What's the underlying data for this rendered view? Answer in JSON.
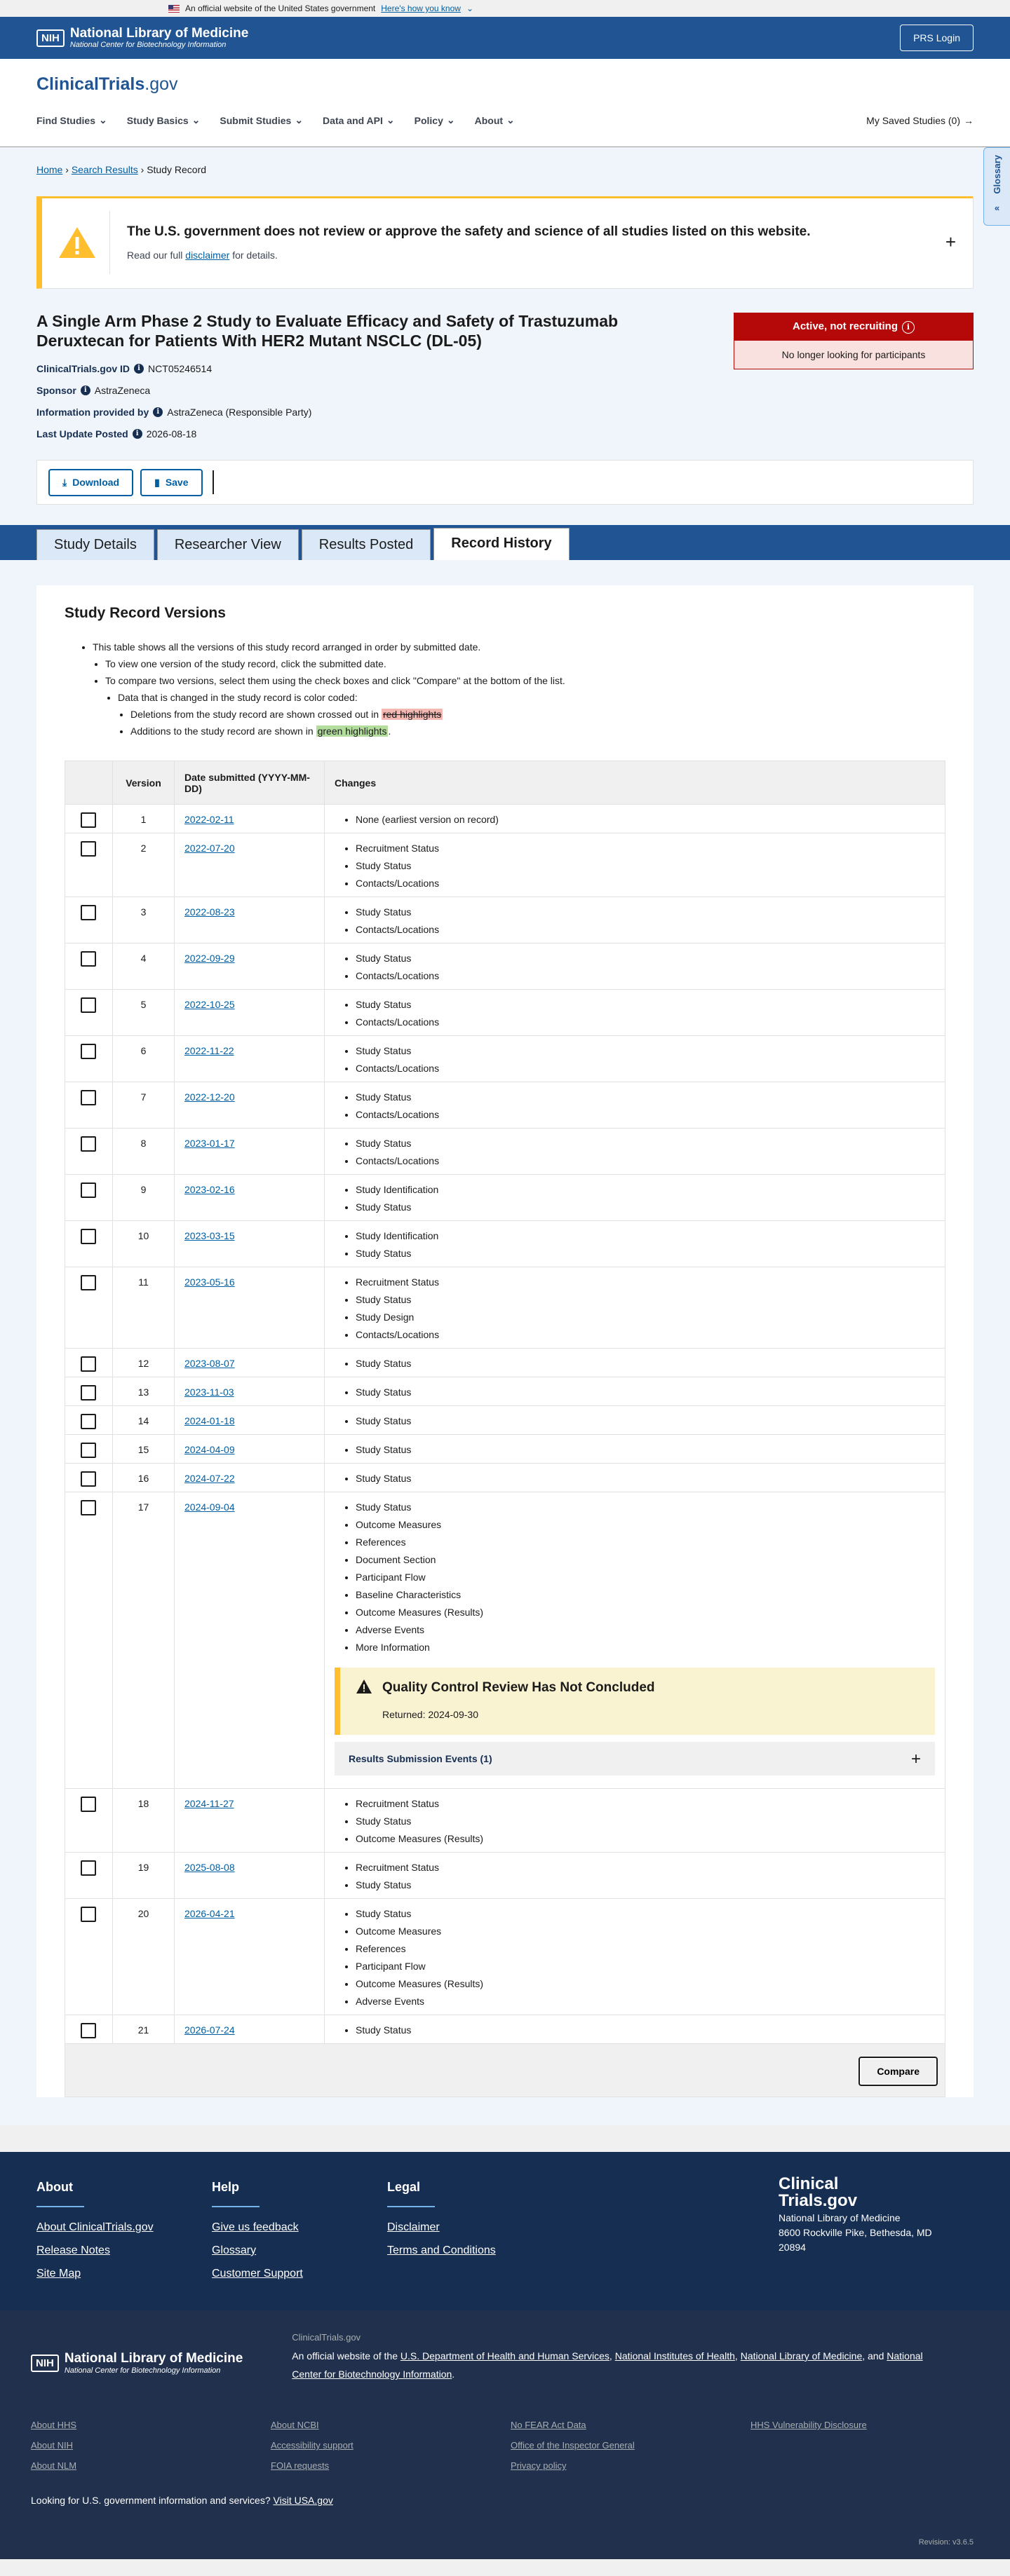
{
  "gov_banner": {
    "text": "An official website of the United States government",
    "link": "Here's how you know"
  },
  "nlm": {
    "nih": "NIH",
    "title": "National Library of Medicine",
    "subtitle": "National Center for Biotechnology Information",
    "prs_login": "PRS Login"
  },
  "site": {
    "logo_main": "ClinicalTrials",
    "logo_suffix": ".gov"
  },
  "nav": {
    "items": [
      "Find Studies",
      "Study Basics",
      "Submit Studies",
      "Data and API",
      "Policy",
      "About"
    ],
    "saved": "My Saved Studies (0)"
  },
  "breadcrumb": {
    "home": "Home",
    "results": "Search Results",
    "current": "Study Record"
  },
  "glossary": "Glossary",
  "alert": {
    "title": "The U.S. government does not review or approve the safety and science of all studies listed on this website.",
    "pre": "Read our full",
    "link": "disclaimer",
    "post": "for details."
  },
  "study": {
    "title": "A Single Arm Phase 2 Study to Evaluate Efficacy and Safety of Trastuzumab Deruxtecan for Patients With HER2 Mutant NSCLC (DL-05)",
    "id_label": "ClinicalTrials.gov ID",
    "id": "NCT05246514",
    "sponsor_label": "Sponsor",
    "sponsor": "AstraZeneca",
    "info_label": "Information provided by",
    "info": "AstraZeneca (Responsible Party)",
    "posted_label": "Last Update Posted",
    "posted": "2026-08-18",
    "status": "Active, not recruiting",
    "status_sub": "No longer looking for participants"
  },
  "actions": {
    "download": "Download",
    "save": "Save"
  },
  "tabs": [
    "Study Details",
    "Researcher View",
    "Results Posted",
    "Record History"
  ],
  "versions": {
    "heading": "Study Record Versions",
    "bullets": {
      "b1": "This table shows all the versions of this study record arranged in order by submitted date.",
      "b2": "To view one version of the study record, click the submitted date.",
      "b3": "To compare two versions, select them using the check boxes and click \"Compare\" at the bottom of the list.",
      "b4": "Data that is changed in the study record is color coded:",
      "b5_pre": "Deletions from the study record are shown crossed out in",
      "b5_hl": "red highlights",
      "b6_pre": "Additions to the study record are shown in",
      "b6_hl": "green highlights",
      "b6_post": "."
    },
    "col_version": "Version",
    "col_date": "Date submitted (YYYY-MM-DD)",
    "col_changes": "Changes",
    "rows": [
      {
        "v": "1",
        "d": "2022-02-11",
        "c": [
          "None (earliest version on record)"
        ]
      },
      {
        "v": "2",
        "d": "2022-07-20",
        "c": [
          "Recruitment Status",
          "Study Status",
          "Contacts/Locations"
        ]
      },
      {
        "v": "3",
        "d": "2022-08-23",
        "c": [
          "Study Status",
          "Contacts/Locations"
        ]
      },
      {
        "v": "4",
        "d": "2022-09-29",
        "c": [
          "Study Status",
          "Contacts/Locations"
        ]
      },
      {
        "v": "5",
        "d": "2022-10-25",
        "c": [
          "Study Status",
          "Contacts/Locations"
        ]
      },
      {
        "v": "6",
        "d": "2022-11-22",
        "c": [
          "Study Status",
          "Contacts/Locations"
        ]
      },
      {
        "v": "7",
        "d": "2022-12-20",
        "c": [
          "Study Status",
          "Contacts/Locations"
        ]
      },
      {
        "v": "8",
        "d": "2023-01-17",
        "c": [
          "Study Status",
          "Contacts/Locations"
        ]
      },
      {
        "v": "9",
        "d": "2023-02-16",
        "c": [
          "Study Identification",
          "Study Status"
        ]
      },
      {
        "v": "10",
        "d": "2023-03-15",
        "c": [
          "Study Identification",
          "Study Status"
        ]
      },
      {
        "v": "11",
        "d": "2023-05-16",
        "c": [
          "Recruitment Status",
          "Study Status",
          "Study Design",
          "Contacts/Locations"
        ]
      },
      {
        "v": "12",
        "d": "2023-08-07",
        "c": [
          "Study Status"
        ]
      },
      {
        "v": "13",
        "d": "2023-11-03",
        "c": [
          "Study Status"
        ]
      },
      {
        "v": "14",
        "d": "2024-01-18",
        "c": [
          "Study Status"
        ]
      },
      {
        "v": "15",
        "d": "2024-04-09",
        "c": [
          "Study Status"
        ]
      },
      {
        "v": "16",
        "d": "2024-07-22",
        "c": [
          "Study Status"
        ]
      },
      {
        "v": "17",
        "d": "2024-09-04",
        "c": [
          "Study Status",
          "Outcome Measures",
          "References",
          "Document Section",
          "Participant Flow",
          "Baseline Characteristics",
          "Outcome Measures (Results)",
          "Adverse Events",
          "More Information"
        ],
        "qc": true
      },
      {
        "v": "18",
        "d": "2024-11-27",
        "c": [
          "Recruitment Status",
          "Study Status",
          "Outcome Measures (Results)"
        ]
      },
      {
        "v": "19",
        "d": "2025-08-08",
        "c": [
          "Recruitment Status",
          "Study Status"
        ]
      },
      {
        "v": "20",
        "d": "2026-04-21",
        "c": [
          "Study Status",
          "Outcome Measures",
          "References",
          "Participant Flow",
          "Outcome Measures (Results)",
          "Adverse Events"
        ]
      },
      {
        "v": "21",
        "d": "2026-07-24",
        "c": [
          "Study Status"
        ]
      }
    ],
    "qc_title": "Quality Control Review Has Not Concluded",
    "qc_returned": "Returned: 2024-09-30",
    "rse": "Results Submission Events (1)",
    "compare": "Compare"
  },
  "footer": {
    "about": {
      "heading": "About",
      "links": [
        "About ClinicalTrials.gov",
        "Release Notes",
        "Site Map"
      ]
    },
    "help": {
      "heading": "Help",
      "links": [
        "Give us feedback",
        "Glossary",
        "Customer Support"
      ]
    },
    "legal": {
      "heading": "Legal",
      "links": [
        "Disclaimer",
        "Terms and Conditions"
      ]
    },
    "brand": {
      "l1": "Clinical",
      "l2": "Trials.gov",
      "org": "National Library of Medicine",
      "addr1": "8600 Rockville Pike, Bethesda, MD",
      "addr2": "20894"
    }
  },
  "footer2": {
    "site": "ClinicalTrials.gov",
    "intro": "An official website of the",
    "l1": "U.S. Department of Health and Human Services",
    "l2": "National Institutes of Health",
    "l3": "National Library of Medicine",
    "and": "and",
    "l4": "National Center for Biotechnology Information",
    "links": [
      "About HHS",
      "About NCBI",
      "No FEAR Act Data",
      "HHS Vulnerability Disclosure",
      "About NIH",
      "Accessibility support",
      "Office of the Inspector General",
      "",
      "About NLM",
      "FOIA requests",
      "Privacy policy",
      ""
    ],
    "usa_pre": "Looking for U.S. government information and services?",
    "usa_link": "Visit USA.gov",
    "revision": "Revision: v3.6.5"
  }
}
